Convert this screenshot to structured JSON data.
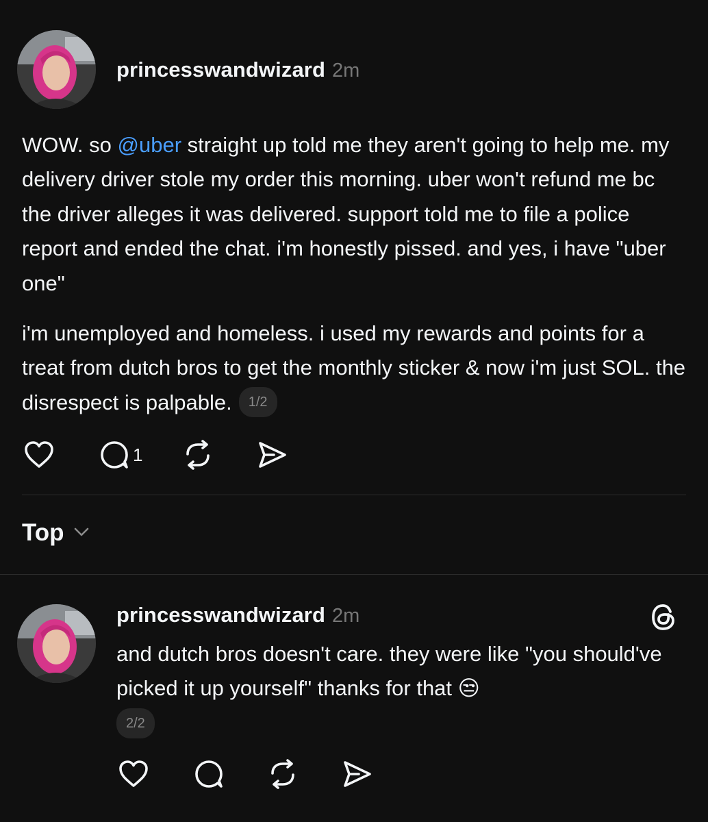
{
  "post": {
    "username": "princesswandwizard",
    "time": "2m",
    "text_part1": "WOW. so ",
    "mention": "@uber",
    "text_part2": " straight up told me they aren't going to help me. my delivery driver stole my order this morning. uber won't refund me bc the driver alleges it was delivered. support told me to file a police report and ended the chat. i'm honestly pissed. and yes, i have \"uber one\"",
    "paragraph2": "i'm unemployed and homeless. i used my rewards and points for a treat from dutch bros to get the monthly sticker & now i'm just SOL. the disrespect is palpable.",
    "counter": "1/2",
    "reply_count": "1"
  },
  "sort": {
    "label": "Top"
  },
  "reply": {
    "username": "princesswandwizard",
    "time": "2m",
    "text": "and dutch bros doesn't care. they were like \"you should've picked it up yourself\" thanks for that 😒",
    "counter": "2/2"
  },
  "icons": {
    "like": "heart-icon",
    "comment": "comment-bubble-icon",
    "repost": "repost-icon",
    "share": "send-icon",
    "threads": "threads-logo-icon",
    "chevron": "chevron-down-icon"
  },
  "colors": {
    "background": "#101010",
    "text": "#f3f5f7",
    "secondary": "#777777",
    "mention": "#4a9eff",
    "divider": "#2d2d2d"
  }
}
